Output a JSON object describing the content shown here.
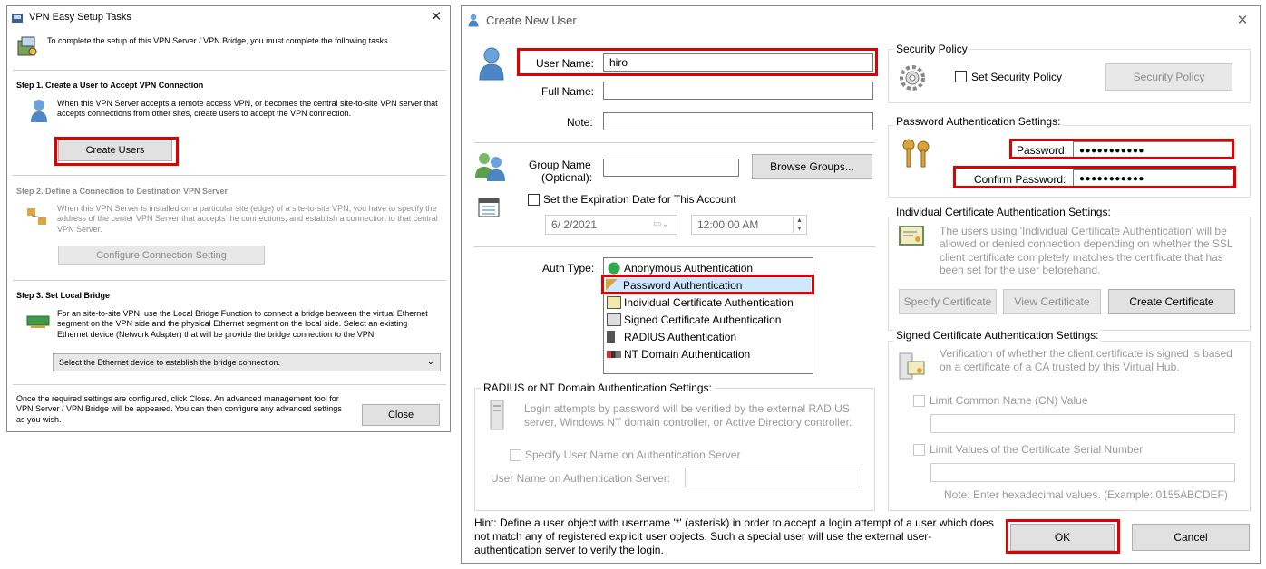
{
  "easy_setup": {
    "title": "VPN Easy Setup Tasks",
    "intro": "To complete the setup of this VPN Server / VPN Bridge, you must complete the following tasks.",
    "step1": {
      "heading": "Step 1. Create a User to Accept VPN Connection",
      "desc": "When this VPN Server accepts a remote access VPN, or becomes the central site-to-site VPN server that accepts connections from other sites, create users to accept the VPN connection.",
      "button": "Create Users"
    },
    "step2": {
      "heading": "Step 2. Define a Connection to Destination VPN Server",
      "desc": "When this VPN Server is installed on a particular site (edge) of a site-to-site VPN, you have to specify the address of the center VPN Server that accepts the connections, and establish a connection to that central VPN Server.",
      "button": "Configure Connection Setting"
    },
    "step3": {
      "heading": "Step 3. Set Local Bridge",
      "desc": "For an site-to-site VPN, use the Local Bridge Function to connect a bridge between the virtual Ethernet segment on the VPN side and the physical Ethernet segment on the local side. Select an existing Ethernet device (Network Adapter) that will be provide the bridge connection to the VPN.",
      "select": "Select the Ethernet device to establish the bridge connection."
    },
    "footer": "Once the required settings are configured, click Close. An advanced management tool for VPN Server / VPN Bridge will be appeared. You can then configure any advanced settings as you wish.",
    "close_button": "Close"
  },
  "create_user": {
    "title": "Create New User",
    "user_name_label": "User Name:",
    "user_name_value": "hiro",
    "full_name_label": "Full Name:",
    "note_label": "Note:",
    "group_label_1": "Group Name",
    "group_label_2": "(Optional):",
    "browse_groups": "Browse Groups...",
    "expiration_label": "Set the Expiration Date for This Account",
    "date_value": "6/  2/2021",
    "time_value": "12:00:00 AM",
    "auth_type_label": "Auth Type:",
    "auth_types": [
      "Anonymous Authentication",
      "Password Authentication",
      "Individual Certificate Authentication",
      "Signed Certificate Authentication",
      "RADIUS Authentication",
      "NT Domain Authentication"
    ],
    "radius": {
      "title": "RADIUS or NT Domain Authentication Settings:",
      "desc": "Login attempts by password will be verified by the external RADIUS server, Windows NT domain controller, or Active Directory controller.",
      "specify_label": "Specify User Name on Authentication Server",
      "username_label": "User Name on Authentication Server:"
    },
    "security_policy": {
      "title": "Security Policy",
      "checkbox_label": "Set Security Policy",
      "button": "Security Policy"
    },
    "password": {
      "title": "Password Authentication Settings:",
      "password_label": "Password:",
      "password_value": "●●●●●●●●●●●",
      "confirm_label": "Confirm Password:",
      "confirm_value": "●●●●●●●●●●●"
    },
    "individual_cert": {
      "title": "Individual Certificate Authentication Settings:",
      "desc": "The users using 'Individual Certificate Authentication' will be allowed or denied connection depending on whether the SSL client certificate completely matches the certificate that has been set for the user beforehand.",
      "specify_button": "Specify Certificate",
      "view_button": "View Certificate",
      "create_button": "Create Certificate"
    },
    "signed_cert": {
      "title": "Signed Certificate Authentication Settings:",
      "desc": "Verification of whether the client certificate is signed is based on a certificate of a CA trusted by this Virtual Hub.",
      "limit_cn": "Limit Common Name (CN) Value",
      "limit_serial": "Limit Values of the Certificate Serial Number",
      "note": "Note: Enter hexadecimal values. (Example: 0155ABCDEF)"
    },
    "hint": "Hint: Define a user object with username '*' (asterisk) in order to accept a login attempt of a user which does not match any of registered explicit user objects. Such a special user will use the external user-authentication server to verify the login.",
    "ok_button": "OK",
    "cancel_button": "Cancel"
  },
  "colors": {
    "highlight": "#e00000",
    "selection": "#cde8ff"
  }
}
